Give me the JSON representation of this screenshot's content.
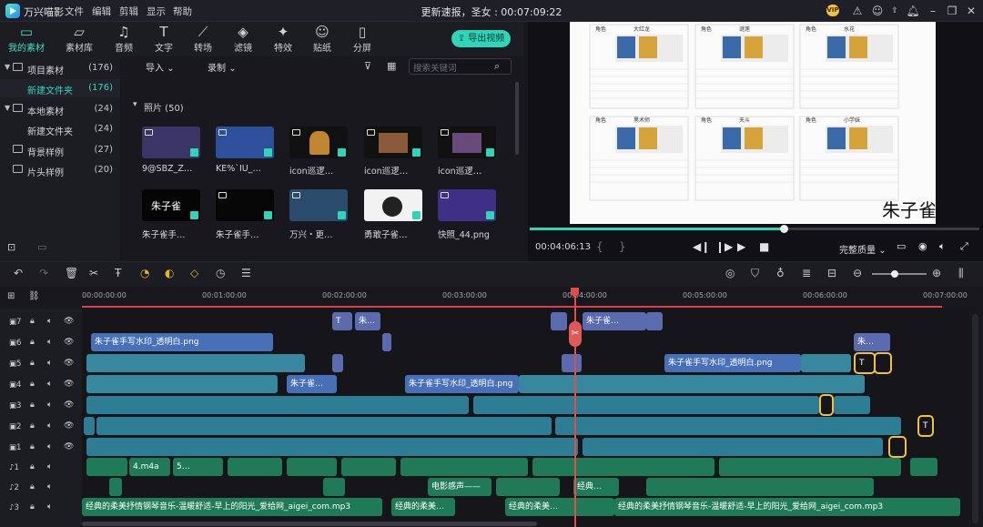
{
  "app": {
    "name": "万兴喵影",
    "window_title": "更新速报，圣女 : 00:07:09:22"
  },
  "menu": [
    "文件",
    "编辑",
    "剪辑",
    "显示",
    "帮助"
  ],
  "titlebar_icons": [
    "vip-badge",
    "notification-icon",
    "user-icon",
    "upload-icon",
    "bell-icon",
    "minimize-icon",
    "restore-icon",
    "close-icon"
  ],
  "vip_label": "VIP",
  "tool_tabs": [
    {
      "label": "我的素材",
      "icon": "folder-icon",
      "active": true
    },
    {
      "label": "素材库",
      "icon": "library-icon"
    },
    {
      "label": "音频",
      "icon": "music-icon"
    },
    {
      "label": "文字",
      "icon": "text-icon"
    },
    {
      "label": "转场",
      "icon": "transition-icon"
    },
    {
      "label": "滤镜",
      "icon": "filter-icon"
    },
    {
      "label": "特效",
      "icon": "effects-icon"
    },
    {
      "label": "贴纸",
      "icon": "sticker-icon"
    },
    {
      "label": "分屏",
      "icon": "split-screen-icon"
    }
  ],
  "export_label": "导出视频",
  "sidebar": {
    "items": [
      {
        "label": "项目素材",
        "count": "(176)",
        "level": 0,
        "expanded": true
      },
      {
        "label": "新建文件夹",
        "count": "(176)",
        "level": 1,
        "active": true
      },
      {
        "label": "本地素材",
        "count": "(24)",
        "level": 0,
        "expanded": true
      },
      {
        "label": "新建文件夹",
        "count": "(24)",
        "level": 1
      },
      {
        "label": "背景样例",
        "count": "(27)",
        "level": 0
      },
      {
        "label": "片头样例",
        "count": "(20)",
        "level": 0
      }
    ]
  },
  "media": {
    "import_label": "导入",
    "record_label": "录制",
    "search_placeholder": "搜索关键词",
    "section_label": "照片 (50)",
    "items": [
      {
        "caption": "9@SBZ_Z…",
        "color": "#3b3566"
      },
      {
        "caption": "KE%`IU_…",
        "color": "#2e4f9c"
      },
      {
        "caption": "icon巡逻…",
        "color": "#111111"
      },
      {
        "caption": "icon巡逻…",
        "color": "#111111"
      },
      {
        "caption": "icon巡逻…",
        "color": "#111111"
      },
      {
        "caption": "朱子雀手…",
        "color": "#050505"
      },
      {
        "caption": "朱子雀手…",
        "color": "#060606"
      },
      {
        "caption": "万兴・更…",
        "color": "#2b4b6d"
      },
      {
        "caption": "勇敢子雀…",
        "color": "#f2f2f2"
      },
      {
        "caption": "快照_44.png",
        "color": "#3f2f86"
      }
    ]
  },
  "preview": {
    "timecode": "00:04:06:13",
    "brace_left": "{",
    "brace_right": "}",
    "quality_label": "完整质量",
    "played_fraction": 0.56,
    "watermark": "朱子雀",
    "table_headers": [
      "角色",
      "大红龙",
      "角色",
      "谜莲",
      "角色",
      "水花"
    ],
    "table_headers2": [
      "角色",
      "黑术师",
      "角色",
      "天斗",
      "角色",
      "小学妹"
    ]
  },
  "ruler_ticks": [
    "00:00:00:00",
    "00:01:00:00",
    "00:02:00:00",
    "00:03:00:00",
    "00:04:00:00",
    "00:05:00:00",
    "00:06:00:00",
    "00:07:00:00"
  ],
  "tracks": [
    {
      "name": "7",
      "kind": "video"
    },
    {
      "name": "6",
      "kind": "video"
    },
    {
      "name": "5",
      "kind": "video"
    },
    {
      "name": "4",
      "kind": "video"
    },
    {
      "name": "3",
      "kind": "video"
    },
    {
      "name": "2",
      "kind": "video"
    },
    {
      "name": "1",
      "kind": "video"
    },
    {
      "name": "1",
      "kind": "audio"
    },
    {
      "name": "2",
      "kind": "audio"
    },
    {
      "name": "3",
      "kind": "audio"
    }
  ],
  "clip_labels": {
    "watermark_png": "朱子雀手写水印_透明白.png",
    "short_zhu": "朱子雀…",
    "music_file": "经典的柔美抒情钢琴音乐-温暖舒适-早上的阳光_爱给网_aigei_com.mp3",
    "short_music": "经典的柔美…",
    "m4a": "4.m4a",
    "audio_a": "5…",
    "electric": "电影感声——",
    "classic": "经典…",
    "zhu_short2": "朱…",
    "letter_t": "T"
  }
}
